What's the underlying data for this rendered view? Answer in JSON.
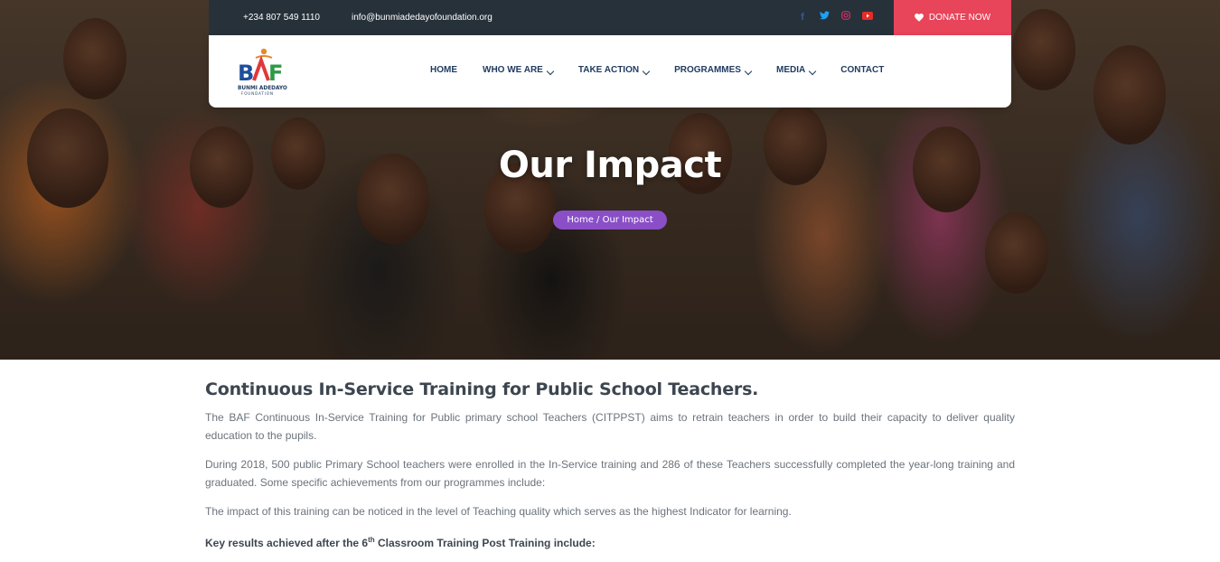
{
  "topbar": {
    "phone": "+234 807 549 1110",
    "email": "info@bunmiadedayofoundation.org",
    "socials": [
      {
        "icon": "facebook-icon",
        "glyph": "f",
        "color": "#3b5998"
      },
      {
        "icon": "twitter-icon",
        "glyph": "t",
        "color": "#1da1f2"
      },
      {
        "icon": "instagram-icon",
        "glyph": "◎",
        "color": "#e1306c"
      },
      {
        "icon": "youtube-icon",
        "glyph": "▶",
        "color": "#e52d27"
      }
    ],
    "donate_label": "DONATE NOW"
  },
  "logo": {
    "text": "BAF",
    "subtext": "BUNMI ADEDAYO FOUNDATION"
  },
  "nav": {
    "items": [
      {
        "label": "HOME",
        "dropdown": false
      },
      {
        "label": "WHO WE ARE",
        "dropdown": true
      },
      {
        "label": "TAKE ACTION",
        "dropdown": true
      },
      {
        "label": "PROGRAMMES",
        "dropdown": true
      },
      {
        "label": "MEDIA",
        "dropdown": true
      },
      {
        "label": "CONTACT",
        "dropdown": false
      }
    ]
  },
  "hero": {
    "title": "Our Impact",
    "breadcrumb_home": "Home",
    "breadcrumb_sep": " / ",
    "breadcrumb_current": "Our Impact"
  },
  "content": {
    "heading": "Continuous In-Service Training for Public School Teachers.",
    "p1": "The BAF Continuous In-Service Training for Public primary school Teachers (CITPPST) aims to retrain teachers in order to build their capacity to deliver quality education to the pupils.",
    "p2": "During 2018, 500 public Primary School teachers were enrolled in the In-Service training and 286 of these Teachers successfully completed the year-long training and graduated. Some specific achievements from our programmes include:",
    "p3": "The impact of this training can be noticed in the level of Teaching quality which serves as the highest Indicator for learning.",
    "key_prefix": "Key results achieved after the 6",
    "key_sup": "th",
    "key_suffix": " Classroom Training Post Training include:"
  },
  "colors": {
    "topbar_bg": "#27313a",
    "donate_bg": "#e8445a",
    "nav_text": "#1f3a5f",
    "breadcrumb_bg": "#8a4fc7"
  }
}
